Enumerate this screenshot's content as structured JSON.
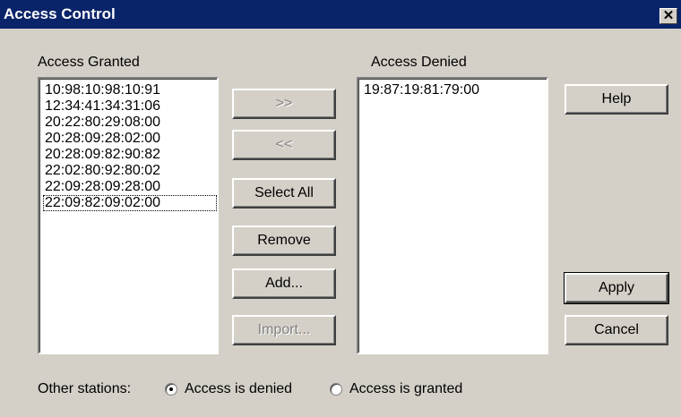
{
  "window": {
    "title": "Access Control",
    "close_glyph": "✕"
  },
  "granted": {
    "label": "Access Granted",
    "items": [
      "10:98:10:98:10:91",
      "12:34:41:34:31:06",
      "20:22:80:29:08:00",
      "20:28:09:28:02:00",
      "20:28:09:82:90:82",
      "22:02:80:92:80:02",
      "22:09:28:09:28:00",
      "22:09:82:09:02:00"
    ]
  },
  "denied": {
    "label": "Access Denied",
    "items": [
      "19:87:19:81:79:00"
    ]
  },
  "buttons": {
    "move_right": ">>",
    "move_left": "<<",
    "select_all": "Select All",
    "remove": "Remove",
    "add": "Add...",
    "import": "Import...",
    "help": "Help",
    "apply": "Apply",
    "cancel": "Cancel"
  },
  "other_stations": {
    "label": "Other stations:",
    "options": [
      "Access is denied",
      "Access is granted"
    ],
    "selected": "Access is denied"
  }
}
